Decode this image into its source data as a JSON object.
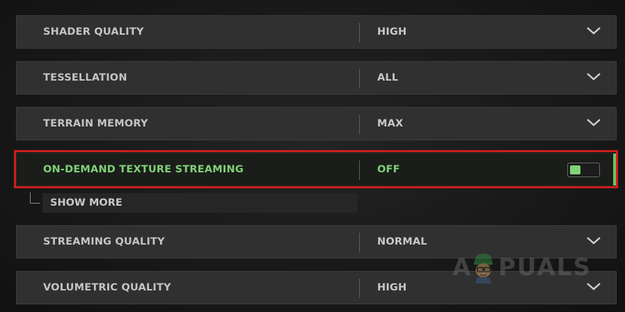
{
  "settings": [
    {
      "label": "SHADER QUALITY",
      "value": "HIGH"
    },
    {
      "label": "TESSELLATION",
      "value": "ALL"
    },
    {
      "label": "TERRAIN MEMORY",
      "value": "MAX"
    },
    {
      "label": "ON-DEMAND TEXTURE STREAMING",
      "value": "OFF"
    },
    {
      "label": "STREAMING QUALITY",
      "value": "NORMAL"
    },
    {
      "label": "VOLUMETRIC QUALITY",
      "value": "HIGH"
    }
  ],
  "show_more_label": "SHOW MORE",
  "watermark": {
    "letter_a": "A",
    "rest": "PUALS"
  },
  "colors": {
    "active_text": "#7fd278",
    "highlight_border": "#cf1d1d",
    "row_background": "#303030"
  },
  "icons": {
    "dropdown": "chevron-down-icon",
    "toggle": "toggle-switch"
  }
}
